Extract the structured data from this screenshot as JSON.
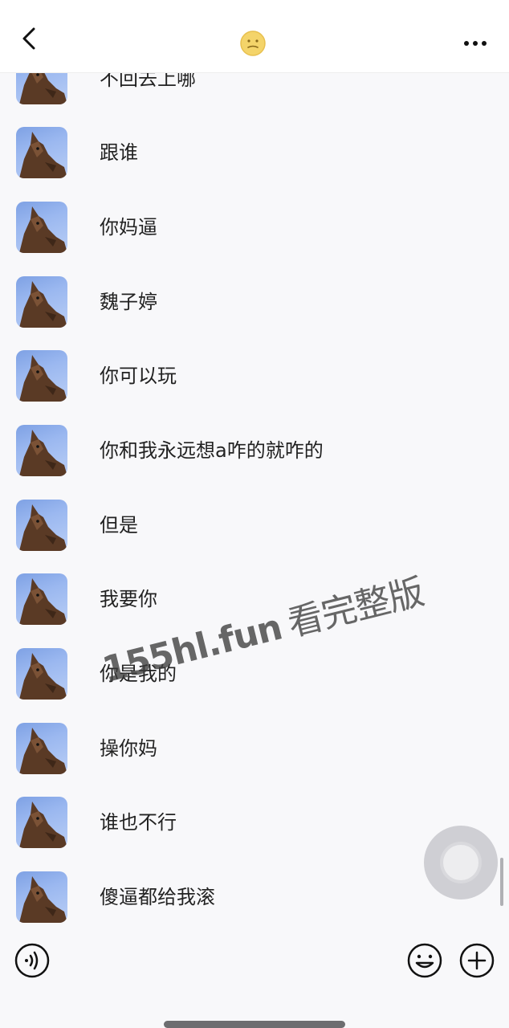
{
  "header": {
    "back_icon": "chevron-left-icon",
    "title_icon": "moon-face-emoji",
    "more_icon": "ellipsis-icon"
  },
  "messages": [
    {
      "text": "不回去上哪",
      "avatar_icon": "dog-avatar"
    },
    {
      "text": "跟谁",
      "avatar_icon": "dog-avatar"
    },
    {
      "text": "你妈逼",
      "avatar_icon": "dog-avatar"
    },
    {
      "text": "魏子婷",
      "avatar_icon": "dog-avatar"
    },
    {
      "text": "你可以玩",
      "avatar_icon": "dog-avatar"
    },
    {
      "text": "你和我永远想a咋的就咋的",
      "avatar_icon": "dog-avatar"
    },
    {
      "text": "但是",
      "avatar_icon": "dog-avatar"
    },
    {
      "text": "我要你",
      "avatar_icon": "dog-avatar"
    },
    {
      "text": "你是我的",
      "avatar_icon": "dog-avatar"
    },
    {
      "text": "操你妈",
      "avatar_icon": "dog-avatar"
    },
    {
      "text": "谁也不行",
      "avatar_icon": "dog-avatar"
    },
    {
      "text": "傻逼都给我滚",
      "avatar_icon": "dog-avatar"
    }
  ],
  "input_bar": {
    "voice_icon": "voice-icon",
    "emoji_icon": "smiley-icon",
    "plus_icon": "plus-icon"
  },
  "watermark": {
    "site": "155hl.fun",
    "text": "看完整版"
  },
  "colors": {
    "background": "#f8f8fa",
    "header_bg": "#ffffff",
    "text": "#222222",
    "avatar_sky": "#9bb8f0",
    "dog_brown": "#5a3a25"
  }
}
